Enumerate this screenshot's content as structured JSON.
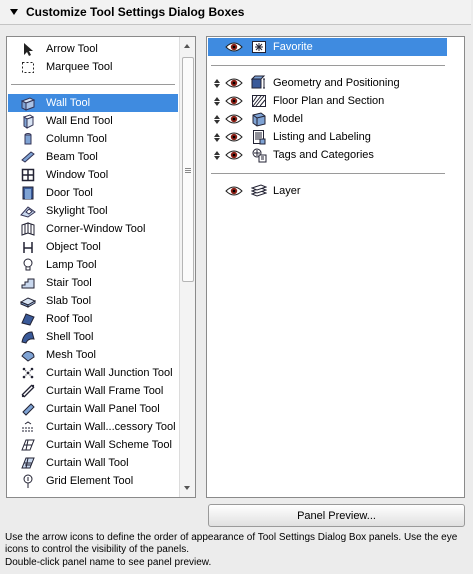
{
  "header": {
    "title": "Customize Tool Settings Dialog Boxes"
  },
  "tools": [
    {
      "label": "Arrow Tool",
      "icon": "arrow-tool-icon",
      "selected": false
    },
    {
      "label": "Marquee Tool",
      "icon": "marquee-tool-icon",
      "selected": false
    },
    {
      "label": "Wall Tool",
      "icon": "wall-tool-icon",
      "selected": true
    },
    {
      "label": "Wall End Tool",
      "icon": "wall-end-tool-icon",
      "selected": false
    },
    {
      "label": "Column Tool",
      "icon": "column-tool-icon",
      "selected": false
    },
    {
      "label": "Beam Tool",
      "icon": "beam-tool-icon",
      "selected": false
    },
    {
      "label": "Window Tool",
      "icon": "window-tool-icon",
      "selected": false
    },
    {
      "label": "Door Tool",
      "icon": "door-tool-icon",
      "selected": false
    },
    {
      "label": "Skylight Tool",
      "icon": "skylight-tool-icon",
      "selected": false
    },
    {
      "label": "Corner-Window Tool",
      "icon": "corner-window-tool-icon",
      "selected": false
    },
    {
      "label": "Object Tool",
      "icon": "object-tool-icon",
      "selected": false
    },
    {
      "label": "Lamp Tool",
      "icon": "lamp-tool-icon",
      "selected": false
    },
    {
      "label": "Stair Tool",
      "icon": "stair-tool-icon",
      "selected": false
    },
    {
      "label": "Slab Tool",
      "icon": "slab-tool-icon",
      "selected": false
    },
    {
      "label": "Roof Tool",
      "icon": "roof-tool-icon",
      "selected": false
    },
    {
      "label": "Shell Tool",
      "icon": "shell-tool-icon",
      "selected": false
    },
    {
      "label": "Mesh Tool",
      "icon": "mesh-tool-icon",
      "selected": false
    },
    {
      "label": "Curtain Wall Junction Tool",
      "icon": "curtain-wall-junction-tool-icon",
      "selected": false
    },
    {
      "label": "Curtain Wall Frame Tool",
      "icon": "curtain-wall-frame-tool-icon",
      "selected": false
    },
    {
      "label": "Curtain Wall Panel Tool",
      "icon": "curtain-wall-panel-tool-icon",
      "selected": false
    },
    {
      "label": "Curtain Wall...cessory Tool",
      "icon": "curtain-wall-accessory-tool-icon",
      "selected": false
    },
    {
      "label": "Curtain Wall Scheme Tool",
      "icon": "curtain-wall-scheme-tool-icon",
      "selected": false
    },
    {
      "label": "Curtain Wall Tool",
      "icon": "curtain-wall-tool-icon",
      "selected": false
    },
    {
      "label": "Grid Element Tool",
      "icon": "grid-element-tool-icon",
      "selected": false
    }
  ],
  "panels": [
    {
      "label": "Favorite",
      "icon": "favorite-panel-icon",
      "selected": true,
      "movable": false,
      "visible": true
    },
    {
      "label": "Geometry and Positioning",
      "icon": "geometry-panel-icon",
      "selected": false,
      "movable": true,
      "visible": true
    },
    {
      "label": "Floor Plan and Section",
      "icon": "floor-plan-panel-icon",
      "selected": false,
      "movable": true,
      "visible": true
    },
    {
      "label": "Model",
      "icon": "model-panel-icon",
      "selected": false,
      "movable": true,
      "visible": true
    },
    {
      "label": "Listing and Labeling",
      "icon": "listing-panel-icon",
      "selected": false,
      "movable": true,
      "visible": true
    },
    {
      "label": "Tags and Categories",
      "icon": "tags-panel-icon",
      "selected": false,
      "movable": true,
      "visible": true
    },
    {
      "label": "Layer",
      "icon": "layer-panel-icon",
      "selected": false,
      "movable": false,
      "visible": true
    }
  ],
  "preview_button": "Panel Preview...",
  "help": {
    "line1": "Use the arrow icons to define the order of appearance of Tool Settings Dialog Box panels. Use the eye icons to control the visibility of the panels.",
    "line2": "Double-click panel name to see panel preview."
  },
  "colors": {
    "selection": "#3f8be0"
  }
}
